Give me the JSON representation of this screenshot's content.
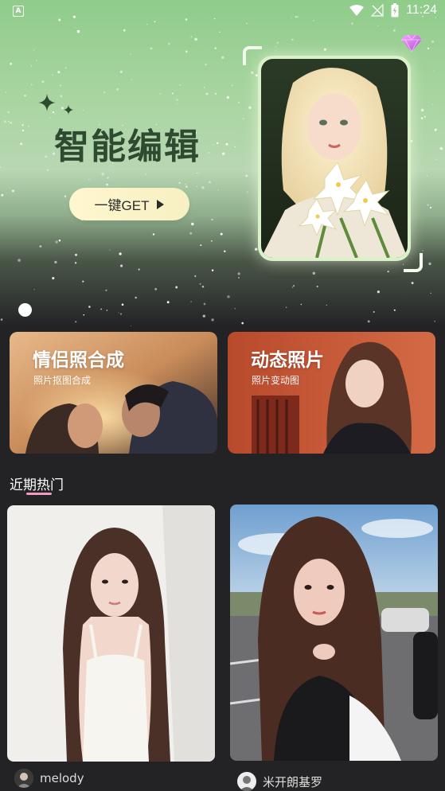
{
  "status_bar": {
    "app_icon": "A",
    "time": "11:24",
    "icons": [
      "wifi-icon",
      "no-signal-icon",
      "battery-charging-icon"
    ]
  },
  "hero": {
    "vip_icon": "diamond-icon",
    "title": "智能编辑",
    "cta_label": "一键GET",
    "cta_icon": "play-triangle-icon",
    "image": "illustrated girl with lilies"
  },
  "feature_cards": [
    {
      "title": "情侣照合成",
      "subtitle": "照片抠图合成"
    },
    {
      "title": "动态照片",
      "subtitle": "照片变动图"
    }
  ],
  "section": {
    "title": "近期热门",
    "accent_color": "#f29ac0"
  },
  "posts": [
    {
      "author": "melody"
    },
    {
      "author": "米开朗基罗"
    }
  ],
  "colors": {
    "background": "#232325",
    "hero_green": "#a9d5a1",
    "title_green": "#2e4a30",
    "cta_yellow": "#fff6cf"
  }
}
